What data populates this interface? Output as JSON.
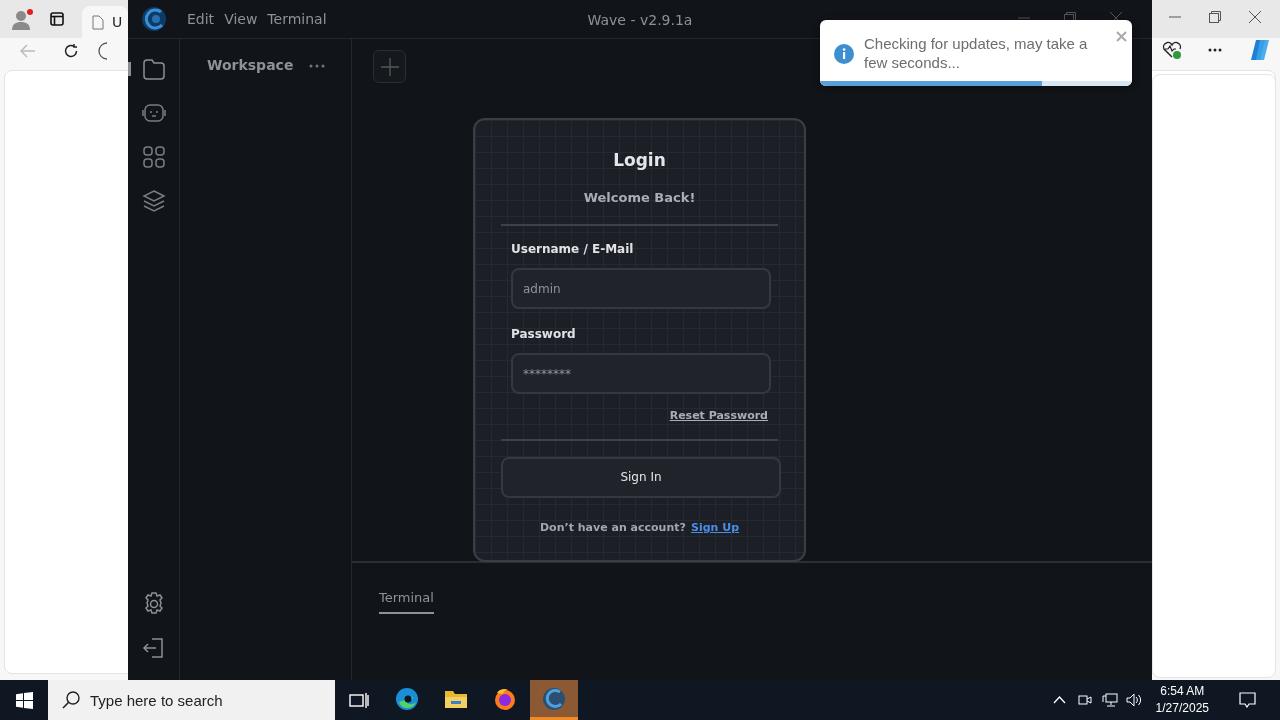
{
  "browser": {
    "tab_label": "U"
  },
  "app": {
    "title": "Wave - v2.9.1a",
    "menu": [
      "Edit",
      "View",
      "Terminal"
    ],
    "activity_items": [
      {
        "kind": "folder",
        "selected": true
      },
      {
        "kind": "robot",
        "selected": false
      },
      {
        "kind": "apps",
        "selected": false
      },
      {
        "kind": "layers",
        "selected": false
      }
    ],
    "activity_bottom": [
      {
        "kind": "settings"
      },
      {
        "kind": "logout"
      }
    ]
  },
  "sidebar": {
    "title": "Workspace"
  },
  "login": {
    "title": "Login",
    "subtitle": "Welcome Back!",
    "fields": [
      {
        "label": "Username / E-Mail",
        "placeholder": "admin"
      },
      {
        "label": "Password",
        "placeholder": "********"
      }
    ],
    "reset_link": "Reset Password",
    "sign_in": "Sign In",
    "prompt": "Don’t have an account?",
    "sign_up_link": "Sign Up"
  },
  "terminal": {
    "tabs": [
      {
        "label": "Terminal",
        "selected": true
      }
    ]
  },
  "toast": {
    "message": "Checking for updates, may take a few seconds...",
    "level": 0.71
  },
  "taskbar": {
    "search": {
      "placeholder": "Type here to search"
    },
    "apps": [
      {
        "kind": "edge",
        "selected": false
      },
      {
        "kind": "explorer",
        "selected": false
      },
      {
        "kind": "firefox",
        "selected": false
      },
      {
        "kind": "wave",
        "selected": true
      }
    ],
    "time": "6:54 AM",
    "date": "1/27/2025"
  }
}
